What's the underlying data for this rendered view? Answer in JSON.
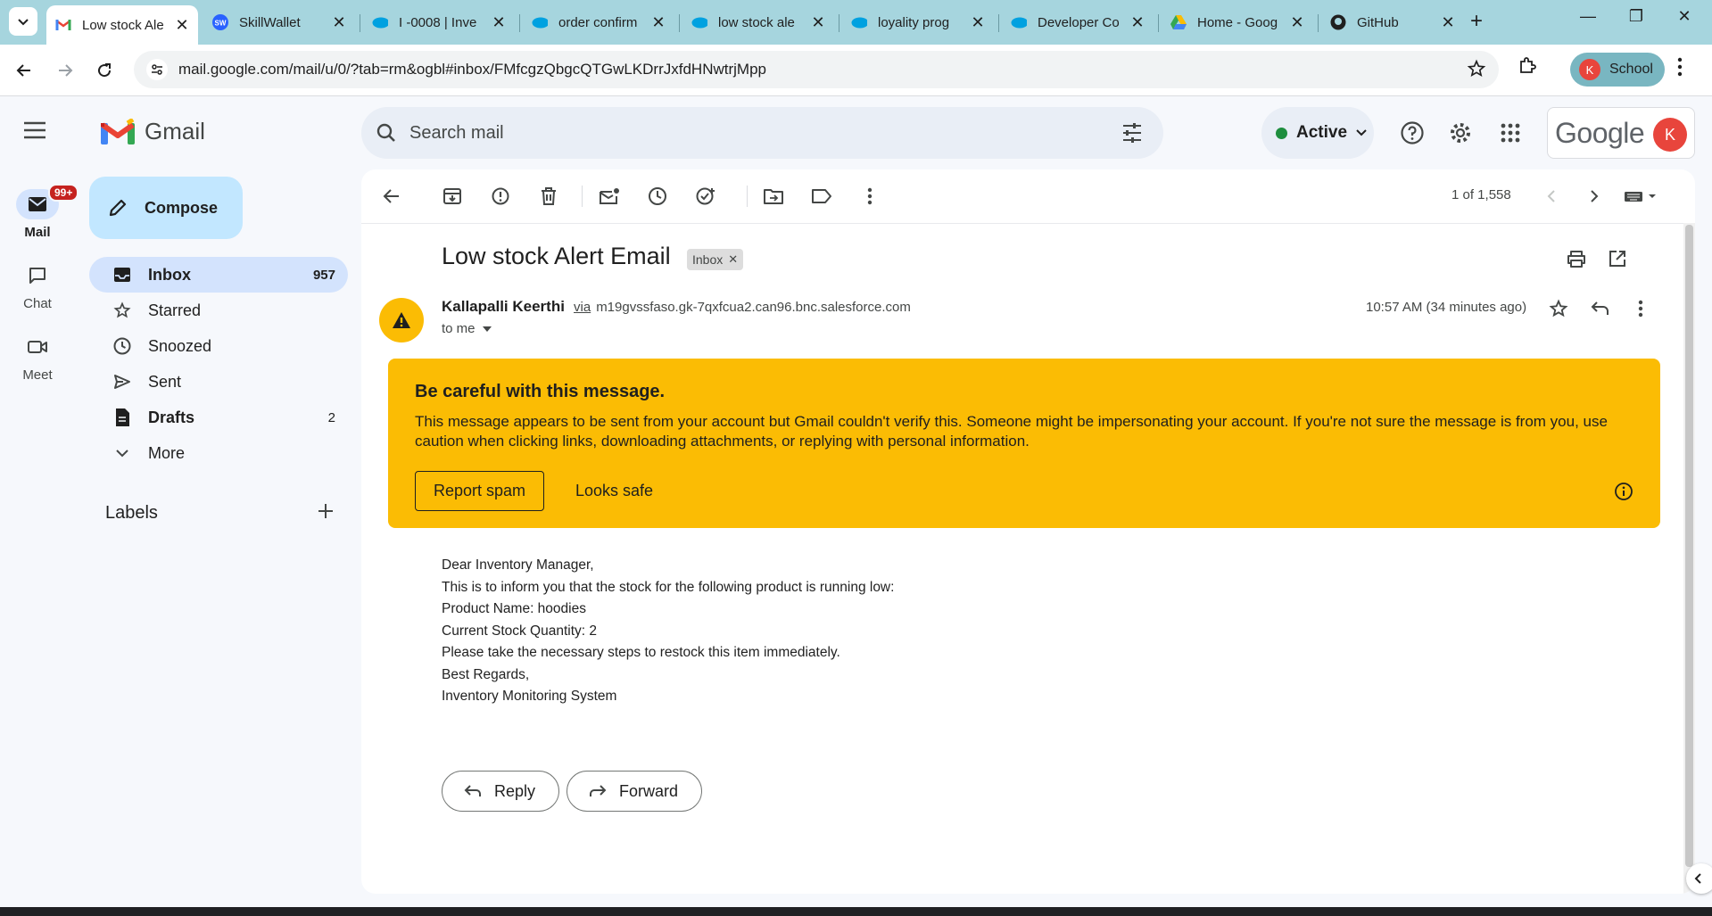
{
  "browser": {
    "tabs": [
      {
        "title": "Low stock Ale",
        "favicon": "gmail-icon"
      },
      {
        "title": "SkillWallet",
        "favicon": "skillwallet-icon"
      },
      {
        "title": "I -0008 | Inve",
        "favicon": "salesforce-icon"
      },
      {
        "title": "order confirm",
        "favicon": "salesforce-icon"
      },
      {
        "title": "low stock ale",
        "favicon": "salesforce-icon"
      },
      {
        "title": "loyality prog",
        "favicon": "salesforce-icon"
      },
      {
        "title": "Developer Co",
        "favicon": "salesforce-icon"
      },
      {
        "title": "Home - Goog",
        "favicon": "google-drive-icon"
      },
      {
        "title": "GitHub",
        "favicon": "github-icon"
      }
    ],
    "url": "mail.google.com/mail/u/0/?tab=rm&ogbl#inbox/FMfcgzQbgcQTGwLKDrrJxfdHNwtrjMpp",
    "profile": {
      "initial": "K",
      "name": "School"
    }
  },
  "gmail": {
    "app_name": "Gmail",
    "search_placeholder": "Search mail",
    "status": "Active",
    "google_word": "Google",
    "account_initial": "K",
    "rail": [
      {
        "label": "Mail",
        "badge": "99+"
      },
      {
        "label": "Chat"
      },
      {
        "label": "Meet"
      }
    ],
    "compose_label": "Compose",
    "folders": [
      {
        "label": "Inbox",
        "count": "957"
      },
      {
        "label": "Starred",
        "count": ""
      },
      {
        "label": "Snoozed",
        "count": ""
      },
      {
        "label": "Sent",
        "count": ""
      },
      {
        "label": "Drafts",
        "count": "2"
      },
      {
        "label": "More",
        "count": ""
      }
    ],
    "labels_heading": "Labels",
    "pager": "1 of 1,558"
  },
  "email": {
    "subject": "Low stock Alert Email",
    "folder_chip": "Inbox",
    "sender_name": "Kallapalli Keerthi",
    "via_word": "via",
    "via_domain": "m19gvssfaso.gk-7qxfcua2.can96.bnc.salesforce.com",
    "recipient": "to me",
    "timestamp": "10:57 AM (34 minutes ago)",
    "warning": {
      "title": "Be careful with this message.",
      "body": "This message appears to be sent from your account but Gmail couldn't verify this. Someone might be impersonating your account. If you're not sure the message is from you, use caution when clicking links, downloading attachments, or replying with personal information.",
      "report_label": "Report spam",
      "safe_label": "Looks safe"
    },
    "body_lines": [
      "Dear Inventory Manager,",
      "This is to inform you that the stock for the following product is running low:",
      "Product Name: hoodies",
      "Current Stock Quantity: 2",
      "Please take the necessary steps to restock this item immediately.",
      "Best Regards,",
      "Inventory Monitoring System"
    ],
    "reply_label": "Reply",
    "forward_label": "Forward"
  },
  "colors": {
    "tabbar": "#a6d5de",
    "warning_bg": "#fbbc04",
    "inbox_active": "#d3e3fd",
    "compose_bg": "#c2e7ff",
    "avatar": "#e8453c"
  }
}
